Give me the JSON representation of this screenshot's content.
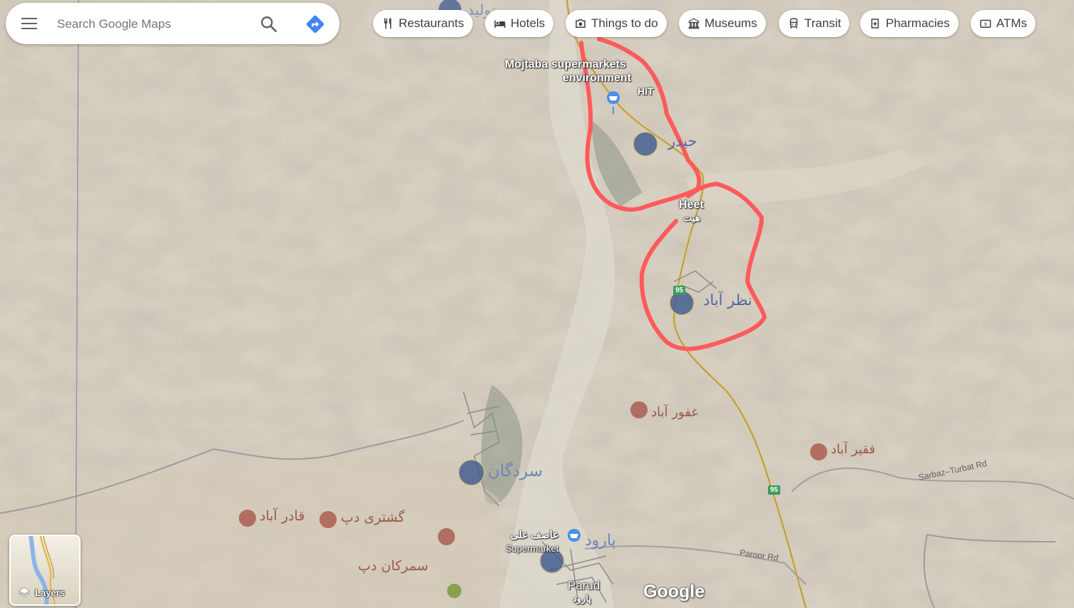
{
  "search": {
    "placeholder": "Search Google Maps"
  },
  "icons": {
    "menu": "menu-icon",
    "search": "search-icon",
    "directions": "directions-icon",
    "restaurants": "fork-knife-icon",
    "hotels": "bed-icon",
    "things": "camera-icon",
    "museums": "museum-icon",
    "transit": "train-icon",
    "pharmacies": "pharmacy-icon",
    "atms": "atm-icon",
    "layers": "layers-icon"
  },
  "chips": [
    {
      "label": "Restaurants"
    },
    {
      "label": "Hotels"
    },
    {
      "label": "Things to do"
    },
    {
      "label": "Museums"
    },
    {
      "label": "Transit"
    },
    {
      "label": "Pharmacies"
    },
    {
      "label": "ATMs"
    }
  ],
  "map": {
    "places": {
      "mojtaba": "Mojtaba supermarkets",
      "environment": "environment",
      "hit": "HIT",
      "heet": "Heet",
      "heet_fa": "هیت",
      "haydar_fa": "حیدر",
      "nazarabad_fa": "نظر آباد",
      "ghafurabad_fa": "غفور آباد",
      "faqirabad_fa": "فقیر آباد",
      "sardgan_fa": "سردگان",
      "ghaderabad_fa": "قادر آباد",
      "geshtari_fa": "گشتری دپ",
      "samarkan_fa": "سمرکان دپ",
      "asef_fa": "عاصف علی",
      "supermarket": "Supermarket",
      "parud_fa": "پارود",
      "parud": "Parud",
      "parud_fa2": "پارود",
      "top_fa": "تولید"
    },
    "roads": {
      "sarbaz": "Sarbaz–Turbat Rd",
      "paroor": "Paroor Rd"
    },
    "route_shield": "95",
    "route_shield_2": "95"
  },
  "layers": {
    "label": "Layers"
  },
  "logo": "Google",
  "colors": {
    "terrain": "#d8d0c2",
    "river": "#ddd8cc",
    "annotation": "#ff5a5a",
    "marker_blue": "#3e5a8f",
    "marker_red": "#a8564a",
    "accent_blue": "#4285f4"
  }
}
